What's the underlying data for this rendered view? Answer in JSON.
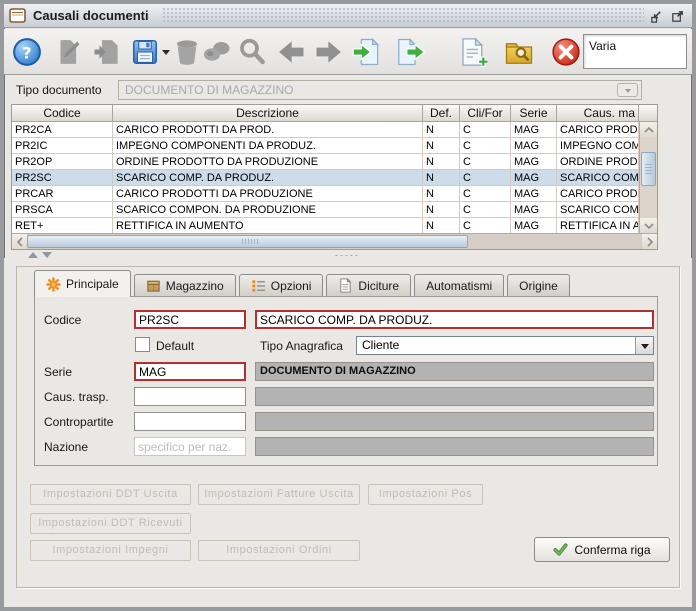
{
  "window": {
    "title": "Causali documenti",
    "icon": "form-window-icon",
    "controls": [
      {
        "name": "iconify-button"
      },
      {
        "name": "maximize-button"
      }
    ]
  },
  "toolbar": {
    "icons": [
      {
        "name": "help-icon",
        "enabled": true
      },
      {
        "name": "edit-document-icon",
        "enabled": false
      },
      {
        "name": "copy-document-icon",
        "enabled": false
      },
      {
        "name": "save-icon",
        "enabled": true
      },
      {
        "name": "save-menu-arrow-icon",
        "enabled": true
      },
      {
        "name": "delete-icon",
        "enabled": false
      },
      {
        "name": "binoculars-icon",
        "enabled": false
      },
      {
        "name": "search-icon",
        "enabled": false
      },
      {
        "name": "previous-icon",
        "enabled": false
      },
      {
        "name": "next-icon",
        "enabled": false
      },
      {
        "name": "document-import-icon",
        "enabled": true
      },
      {
        "name": "document-export-icon",
        "enabled": true
      },
      {
        "name": "new-document-icon",
        "enabled": true
      },
      {
        "name": "archive-search-icon",
        "enabled": true
      },
      {
        "name": "cancel-icon",
        "enabled": true
      }
    ],
    "field_value": "Varia"
  },
  "filter": {
    "label": "Tipo documento",
    "value": "DOCUMENTO DI MAGAZZINO"
  },
  "table": {
    "columns": [
      "Codice",
      "Descrizione",
      "Def.",
      "Cli/For",
      "Serie",
      "Caus. ma"
    ],
    "rows": [
      [
        "PR2CA",
        "CARICO PRODOTTI DA PROD.",
        "N",
        "C",
        "MAG",
        "CARICO PRODOT"
      ],
      [
        "PR2IC",
        "IMPEGNO COMPONENTI DA PRODUZ.",
        "N",
        "C",
        "MAG",
        "IMPEGNO COMPO"
      ],
      [
        "PR2OP",
        "ORDINE PRODOTTO DA PRODUZIONE",
        "N",
        "C",
        "MAG",
        "ORDINE PRODOT"
      ],
      [
        "PR2SC",
        "SCARICO COMP. DA PRODUZ.",
        "N",
        "C",
        "MAG",
        "SCARICO COMP. D"
      ],
      [
        "PRCAR",
        "CARICO PRODOTTI DA PRODUZIONE",
        "N",
        "C",
        "MAG",
        "CARICO PRODOT"
      ],
      [
        "PRSCA",
        "SCARICO COMPON. DA PRODUZIONE",
        "N",
        "C",
        "MAG",
        "SCARICO COMP. D"
      ],
      [
        "RET+",
        "RETTIFICA IN AUMENTO",
        "N",
        "C",
        "MAG",
        "RETTIFICA IN AUM"
      ]
    ],
    "selected_row": "PR2SC",
    "selected_row_index": 3
  },
  "tabs": [
    {
      "label": "Principale",
      "icon": "asterisk-icon",
      "active": true
    },
    {
      "label": "Magazzino",
      "icon": "box-icon",
      "active": false
    },
    {
      "label": "Opzioni",
      "icon": "list-icon",
      "active": false
    },
    {
      "label": "Diciture",
      "icon": "document-icon",
      "active": false
    },
    {
      "label": "Automatismi",
      "icon": "",
      "active": false
    },
    {
      "label": "Origine",
      "icon": "",
      "active": false
    }
  ],
  "form": {
    "codice": {
      "label": "Codice",
      "value": "PR2SC",
      "description": "SCARICO COMP. DA PRODUZ."
    },
    "default_check": {
      "label": "Default",
      "checked": false
    },
    "tipo_anagrafica": {
      "label": "Tipo Anagrafica",
      "value": "Cliente"
    },
    "serie": {
      "label": "Serie",
      "value": "MAG",
      "description": "DOCUMENTO DI MAGAZZINO"
    },
    "caus_trasp": {
      "label": "Caus. trasp.",
      "value": ""
    },
    "contropartite": {
      "label": "Contropartite",
      "value": ""
    },
    "nazione": {
      "label": "Nazione",
      "placeholder": "specifico per naz."
    }
  },
  "buttons": {
    "ddt_uscita": "Impostazioni DDT Uscita",
    "fatture_uscita": "Impostazioni Fatture Uscita",
    "pos": "Impostazioni Pos",
    "ddt_ricevuti": "Impostazioni DDT Ricevuti",
    "impegni": "Impostazioni Impegni",
    "ordini": "Impostazioni Ordini",
    "conferma": "Conferma riga"
  },
  "colors": {
    "required_field_border": "#b43030",
    "selected_row_bg": "#ccdceb",
    "disabled_field_bg": "#b3b3b3",
    "titlebar_bg": "#d6dae1",
    "panel_bg": "#e9e8e5"
  }
}
